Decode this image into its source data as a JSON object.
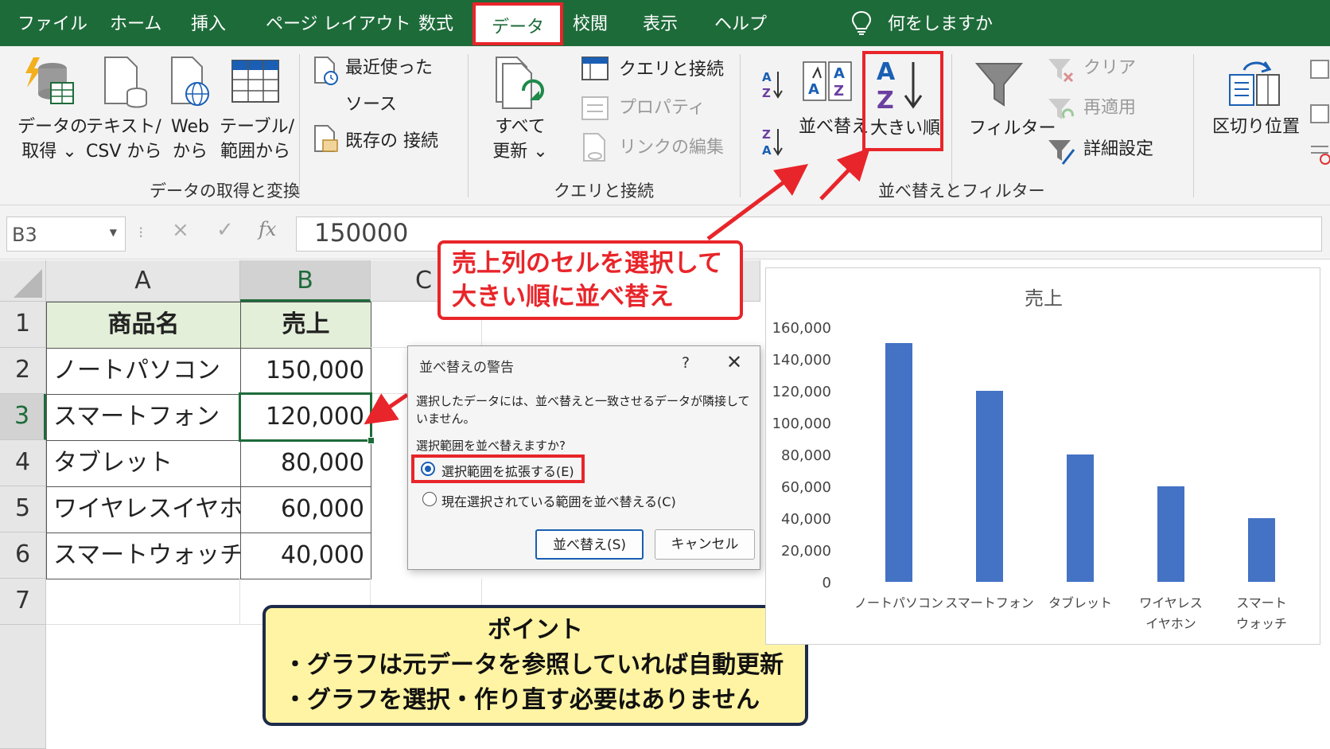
{
  "menu": {
    "tabs": [
      "ファイル",
      "ホーム",
      "挿入",
      "ページ レイアウト",
      "数式",
      "データ",
      "校閲",
      "表示",
      "ヘルプ"
    ],
    "active_tab": "データ",
    "tell_me": "何をしますか"
  },
  "ribbon": {
    "get_data": {
      "l1": "データの",
      "l2": "取得 ⌄"
    },
    "from_text": {
      "l1": "テキスト/",
      "l2": "CSV から"
    },
    "from_web": {
      "l1": "Web",
      "l2": "から"
    },
    "from_table": {
      "l1": "テーブル/",
      "l2": "範囲から"
    },
    "recent_l1": "最近使った",
    "recent_l2": "ソース",
    "existing": "既存の 接続",
    "group1_title": "データの取得と変換",
    "refresh_all": {
      "l1": "すべて",
      "l2": "更新 ⌄"
    },
    "queries": "クエリと接続",
    "properties": "プロパティ",
    "edit_links": "リンクの編集",
    "group2_title": "クエリと接続",
    "sort_asc_glyph": "A↓Z",
    "sort_desc_glyph": "Z↓A",
    "sort": "並べ替え",
    "sort_desc": "大きい順",
    "filter": "フィルター",
    "clear": "クリア",
    "reapply": "再適用",
    "advanced": "詳細設定",
    "group3_title": "並べ替えとフィルター",
    "text_to_columns": "区切り位置"
  },
  "formula_bar": {
    "name_box": "B3",
    "cancel": "×",
    "enter": "✓",
    "fx": "fx",
    "value": "150000"
  },
  "grid": {
    "columns": [
      "A",
      "B",
      "C"
    ],
    "rows": [
      "1",
      "2",
      "3",
      "4",
      "5",
      "6",
      "7"
    ],
    "header": {
      "name": "商品名",
      "sales": "売上"
    },
    "data": [
      {
        "name": "ノートパソコン",
        "sales": "150,000"
      },
      {
        "name": "スマートフォン",
        "sales": "120,000"
      },
      {
        "name": "タブレット",
        "sales": "80,000"
      },
      {
        "name": "ワイヤレスイヤホン",
        "sales": "60,000"
      },
      {
        "name": "スマートウォッチ",
        "sales": "40,000"
      }
    ]
  },
  "callout_red": {
    "l1": "売上列のセルを選択して",
    "l2": "大きい順に並べ替え"
  },
  "callout_yellow": {
    "title": "ポイント",
    "l1": "・グラフは元データを参照していれば自動更新",
    "l2": "・グラフを選択・作り直す必要はありません"
  },
  "dialog": {
    "title": "並べ替えの警告",
    "help": "?",
    "close": "✕",
    "message": "選択したデータには、並べ替えと一致させるデータが隣接していません。",
    "question": "選択範囲を並べ替えますか?",
    "opt_expand": "選択範囲を拡張する(E)",
    "opt_current": "現在選択されている範囲を並べ替える(C)",
    "sort_button": "並べ替え(S)",
    "cancel_button": "キャンセル"
  },
  "colors": {
    "excel_green": "#1e6b3a",
    "highlight_red": "#e8252a",
    "bar_blue": "#4472c4",
    "callout_yellow": "#fff4a3"
  },
  "chart_data": {
    "type": "bar",
    "title": "売上",
    "categories": [
      "ノートパソコン",
      "スマートフォン",
      "タブレット",
      "ワイヤレス\nイヤホン",
      "スマート\nウォッチ"
    ],
    "values": [
      150000,
      120000,
      80000,
      60000,
      40000
    ],
    "ylim": [
      0,
      160000
    ],
    "yticks": [
      0,
      20000,
      40000,
      60000,
      80000,
      100000,
      120000,
      140000,
      160000
    ],
    "ytick_labels": [
      "0",
      "20,000",
      "40,000",
      "60,000",
      "80,000",
      "100,000",
      "120,000",
      "140,000",
      "160,000"
    ],
    "color": "#4472c4",
    "grid": false
  }
}
